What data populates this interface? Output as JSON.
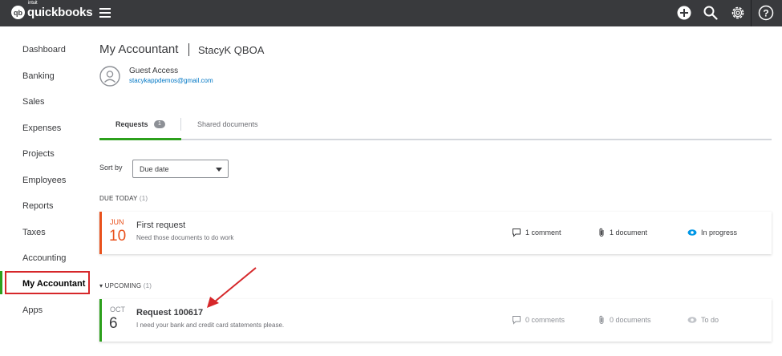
{
  "topbar": {
    "logo_mark": "qb",
    "logo_super": "intuit",
    "logo_text": "quickbooks",
    "icons": [
      "plus-circle-icon",
      "search-icon",
      "gear-icon",
      "help-icon"
    ]
  },
  "sidebar": {
    "items": [
      {
        "label": "Dashboard"
      },
      {
        "label": "Banking"
      },
      {
        "label": "Sales"
      },
      {
        "label": "Expenses"
      },
      {
        "label": "Projects"
      },
      {
        "label": "Employees"
      },
      {
        "label": "Reports"
      },
      {
        "label": "Taxes"
      },
      {
        "label": "Accounting"
      },
      {
        "label": "My Accountant"
      },
      {
        "label": "Apps"
      }
    ]
  },
  "header": {
    "title": "My Accountant",
    "separator": "|",
    "company": "StacyK QBOA",
    "access_label": "Guest Access",
    "email": "stacykappdemos@gmail.com"
  },
  "tabs": {
    "requests_label": "Requests",
    "requests_count": "1",
    "shared_label": "Shared documents"
  },
  "sort": {
    "label": "Sort by",
    "value": "Due date"
  },
  "due_today": {
    "label": "DUE TODAY",
    "count": "(1)",
    "card": {
      "month": "JUN",
      "day": "10",
      "title": "First request",
      "description": "Need those documents to do work",
      "comments": "1  comment",
      "documents": "1  document",
      "status": "In progress"
    }
  },
  "upcoming": {
    "caret": "▾",
    "label": "UPCOMING",
    "count": "(1)",
    "card": {
      "month": "OCT",
      "day": "6",
      "title": "Request 100617",
      "description": "I need your bank and credit card statements please.",
      "comments": "0  comments",
      "documents": "0  documents",
      "status": "To do"
    }
  },
  "colors": {
    "brand_green": "#2ca01c",
    "overdue_orange": "#e9511c",
    "highlight_red": "#d6272a",
    "link_blue": "#0077c5",
    "status_blue": "#0097e6"
  }
}
